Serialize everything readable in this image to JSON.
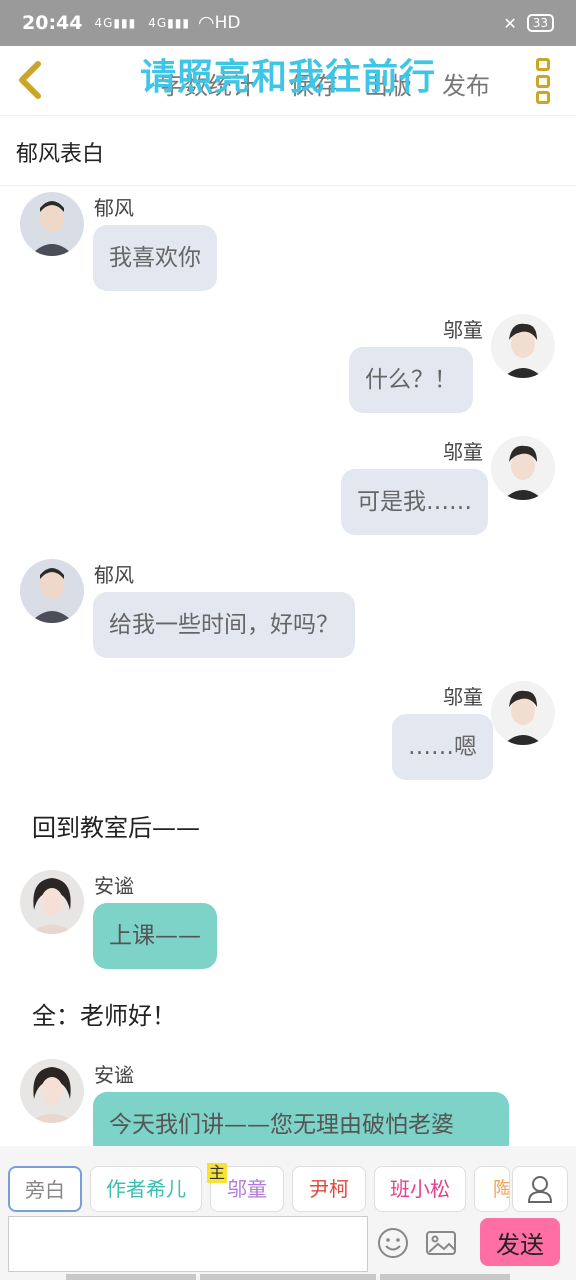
{
  "status_bar": {
    "time": "20:44",
    "signal_1": "4G",
    "signal_2": "4G",
    "wifi_label": "HD",
    "battery": "33",
    "icon_signal": "cell-signal-icon",
    "icon_wifi": "wifi-icon",
    "icon_mute": "vibrate-off-icon"
  },
  "header": {
    "overlay_title": "请照亮和我往前行",
    "word_count_label": "字数统计",
    "save_label": "保存",
    "draft_label": "出版",
    "publish_label": "发布",
    "accent_color": "#3fc6e6",
    "back_icon": "chevron-left-icon",
    "menu_icon": "more-vertical-icon"
  },
  "story_title": "郁风表白",
  "messages": [
    {
      "speaker": "郁风",
      "text": "我喜欢你",
      "side": "left",
      "style": "gray"
    },
    {
      "speaker": "邬童",
      "text": "什么？！",
      "side": "right",
      "style": "gray"
    },
    {
      "speaker": "邬童",
      "text": "可是我……",
      "side": "right",
      "style": "gray"
    },
    {
      "speaker": "郁风",
      "text": "给我一些时间，好吗？",
      "side": "left",
      "style": "gray"
    },
    {
      "speaker": "邬童",
      "text": "……嗯",
      "side": "right",
      "style": "gray"
    },
    {
      "narration": "回到教室后——"
    },
    {
      "speaker": "安谧",
      "text": "上课——",
      "side": "left",
      "style": "teal"
    },
    {
      "narration": "全：老师好！"
    },
    {
      "speaker": "安谧",
      "text": "今天我们讲——您无理由破怕老婆",
      "side": "left",
      "style": "teal"
    }
  ],
  "roles": {
    "items": [
      {
        "label": "旁白",
        "color": "#888888",
        "active": true
      },
      {
        "label": "作者希儿",
        "color": "#3bbfb0",
        "active": false
      },
      {
        "label": "邬童",
        "color": "#b07ad6",
        "active": false,
        "tag": "主"
      },
      {
        "label": "尹柯",
        "color": "#e0483c",
        "active": false
      },
      {
        "label": "班小松",
        "color": "#e6408a",
        "active": false
      },
      {
        "label": "陶",
        "color": "#f5a45a",
        "active": false
      }
    ],
    "user_icon": "user-icon"
  },
  "input_bar": {
    "placeholder": "",
    "emoji_icon": "emoji-icon",
    "image_icon": "image-icon",
    "send_label": "发送",
    "send_color": "#ff6fa3"
  }
}
